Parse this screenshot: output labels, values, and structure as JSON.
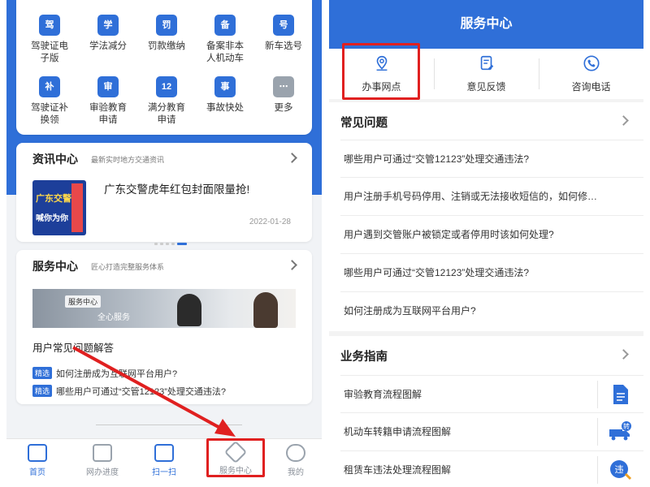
{
  "left": {
    "grid": [
      {
        "icon": "driver-license-icon",
        "glyph": "驾",
        "label": "驾驶证电子版"
      },
      {
        "icon": "book-icon",
        "glyph": "学",
        "label": "学法减分"
      },
      {
        "icon": "receipt-icon",
        "glyph": "罚",
        "label": "罚款缴纳"
      },
      {
        "icon": "shield-icon",
        "glyph": "备",
        "label": "备案非本人机动车"
      },
      {
        "icon": "car-plate-icon",
        "glyph": "号",
        "label": "新车选号"
      },
      {
        "icon": "id-card-icon",
        "glyph": "补",
        "label": "驾驶证补换领"
      },
      {
        "icon": "document-icon",
        "glyph": "审",
        "label": "审验教育申请"
      },
      {
        "icon": "score-doc-icon",
        "glyph": "12",
        "label": "满分教育申请"
      },
      {
        "icon": "police-car-icon",
        "glyph": "事",
        "label": "事故快处"
      },
      {
        "icon": "grid-more-icon",
        "glyph": "⋯",
        "label": "更多"
      }
    ],
    "news": {
      "title": "资讯中心",
      "subtitle": "最新实时地方交通资讯",
      "thumb_line1": "广东交警",
      "thumb_line2": "喊你为你",
      "headline": "广东交警虎年红包封面限量抢!",
      "date": "2022-01-28"
    },
    "service": {
      "title": "服务中心",
      "subtitle": "匠心打造完整服务体系",
      "banner_tag": "服务中心",
      "banner_text": "全心服务",
      "faq_heading": "用户常见问题解答",
      "badge": "精选",
      "faq_items": [
        "如何注册成为互联网平台用户?",
        "哪些用户可通过“交管12123”处理交通违法?"
      ]
    },
    "tabs": [
      {
        "label": "首页",
        "icon": "home-icon"
      },
      {
        "label": "网办进度",
        "icon": "monitor-icon"
      },
      {
        "label": "扫一扫",
        "icon": "scan-icon"
      },
      {
        "label": "服务中心",
        "icon": "diamond-icon"
      },
      {
        "label": "我的",
        "icon": "user-icon"
      }
    ]
  },
  "right": {
    "header_title": "服务中心",
    "top_items": [
      {
        "label": "办事网点",
        "icon": "location-pin-icon"
      },
      {
        "label": "意见反馈",
        "icon": "feedback-doc-icon"
      },
      {
        "label": "咨询电话",
        "icon": "phone-icon"
      }
    ],
    "faq_title": "常见问题",
    "faq_items": [
      "哪些用户可通过“交管12123”处理交通违法?",
      "用户注册手机号码停用、注销或无法接收短信的，如何修…",
      "用户遇到交管账户被锁定或者停用时该如何处理?",
      "哪些用户可通过“交管12123”处理交通违法?",
      "如何注册成为互联网平台用户?"
    ],
    "guide_title": "业务指南",
    "guide_items": [
      {
        "label": "审验教育流程图解",
        "icon": "document-icon"
      },
      {
        "label": "机动车转籍申请流程图解",
        "icon": "truck-transfer-icon"
      },
      {
        "label": "租赁车违法处理流程图解",
        "icon": "violation-icon"
      }
    ]
  },
  "colors": {
    "brand": "#2f6fd8",
    "highlight": "#e02020"
  }
}
